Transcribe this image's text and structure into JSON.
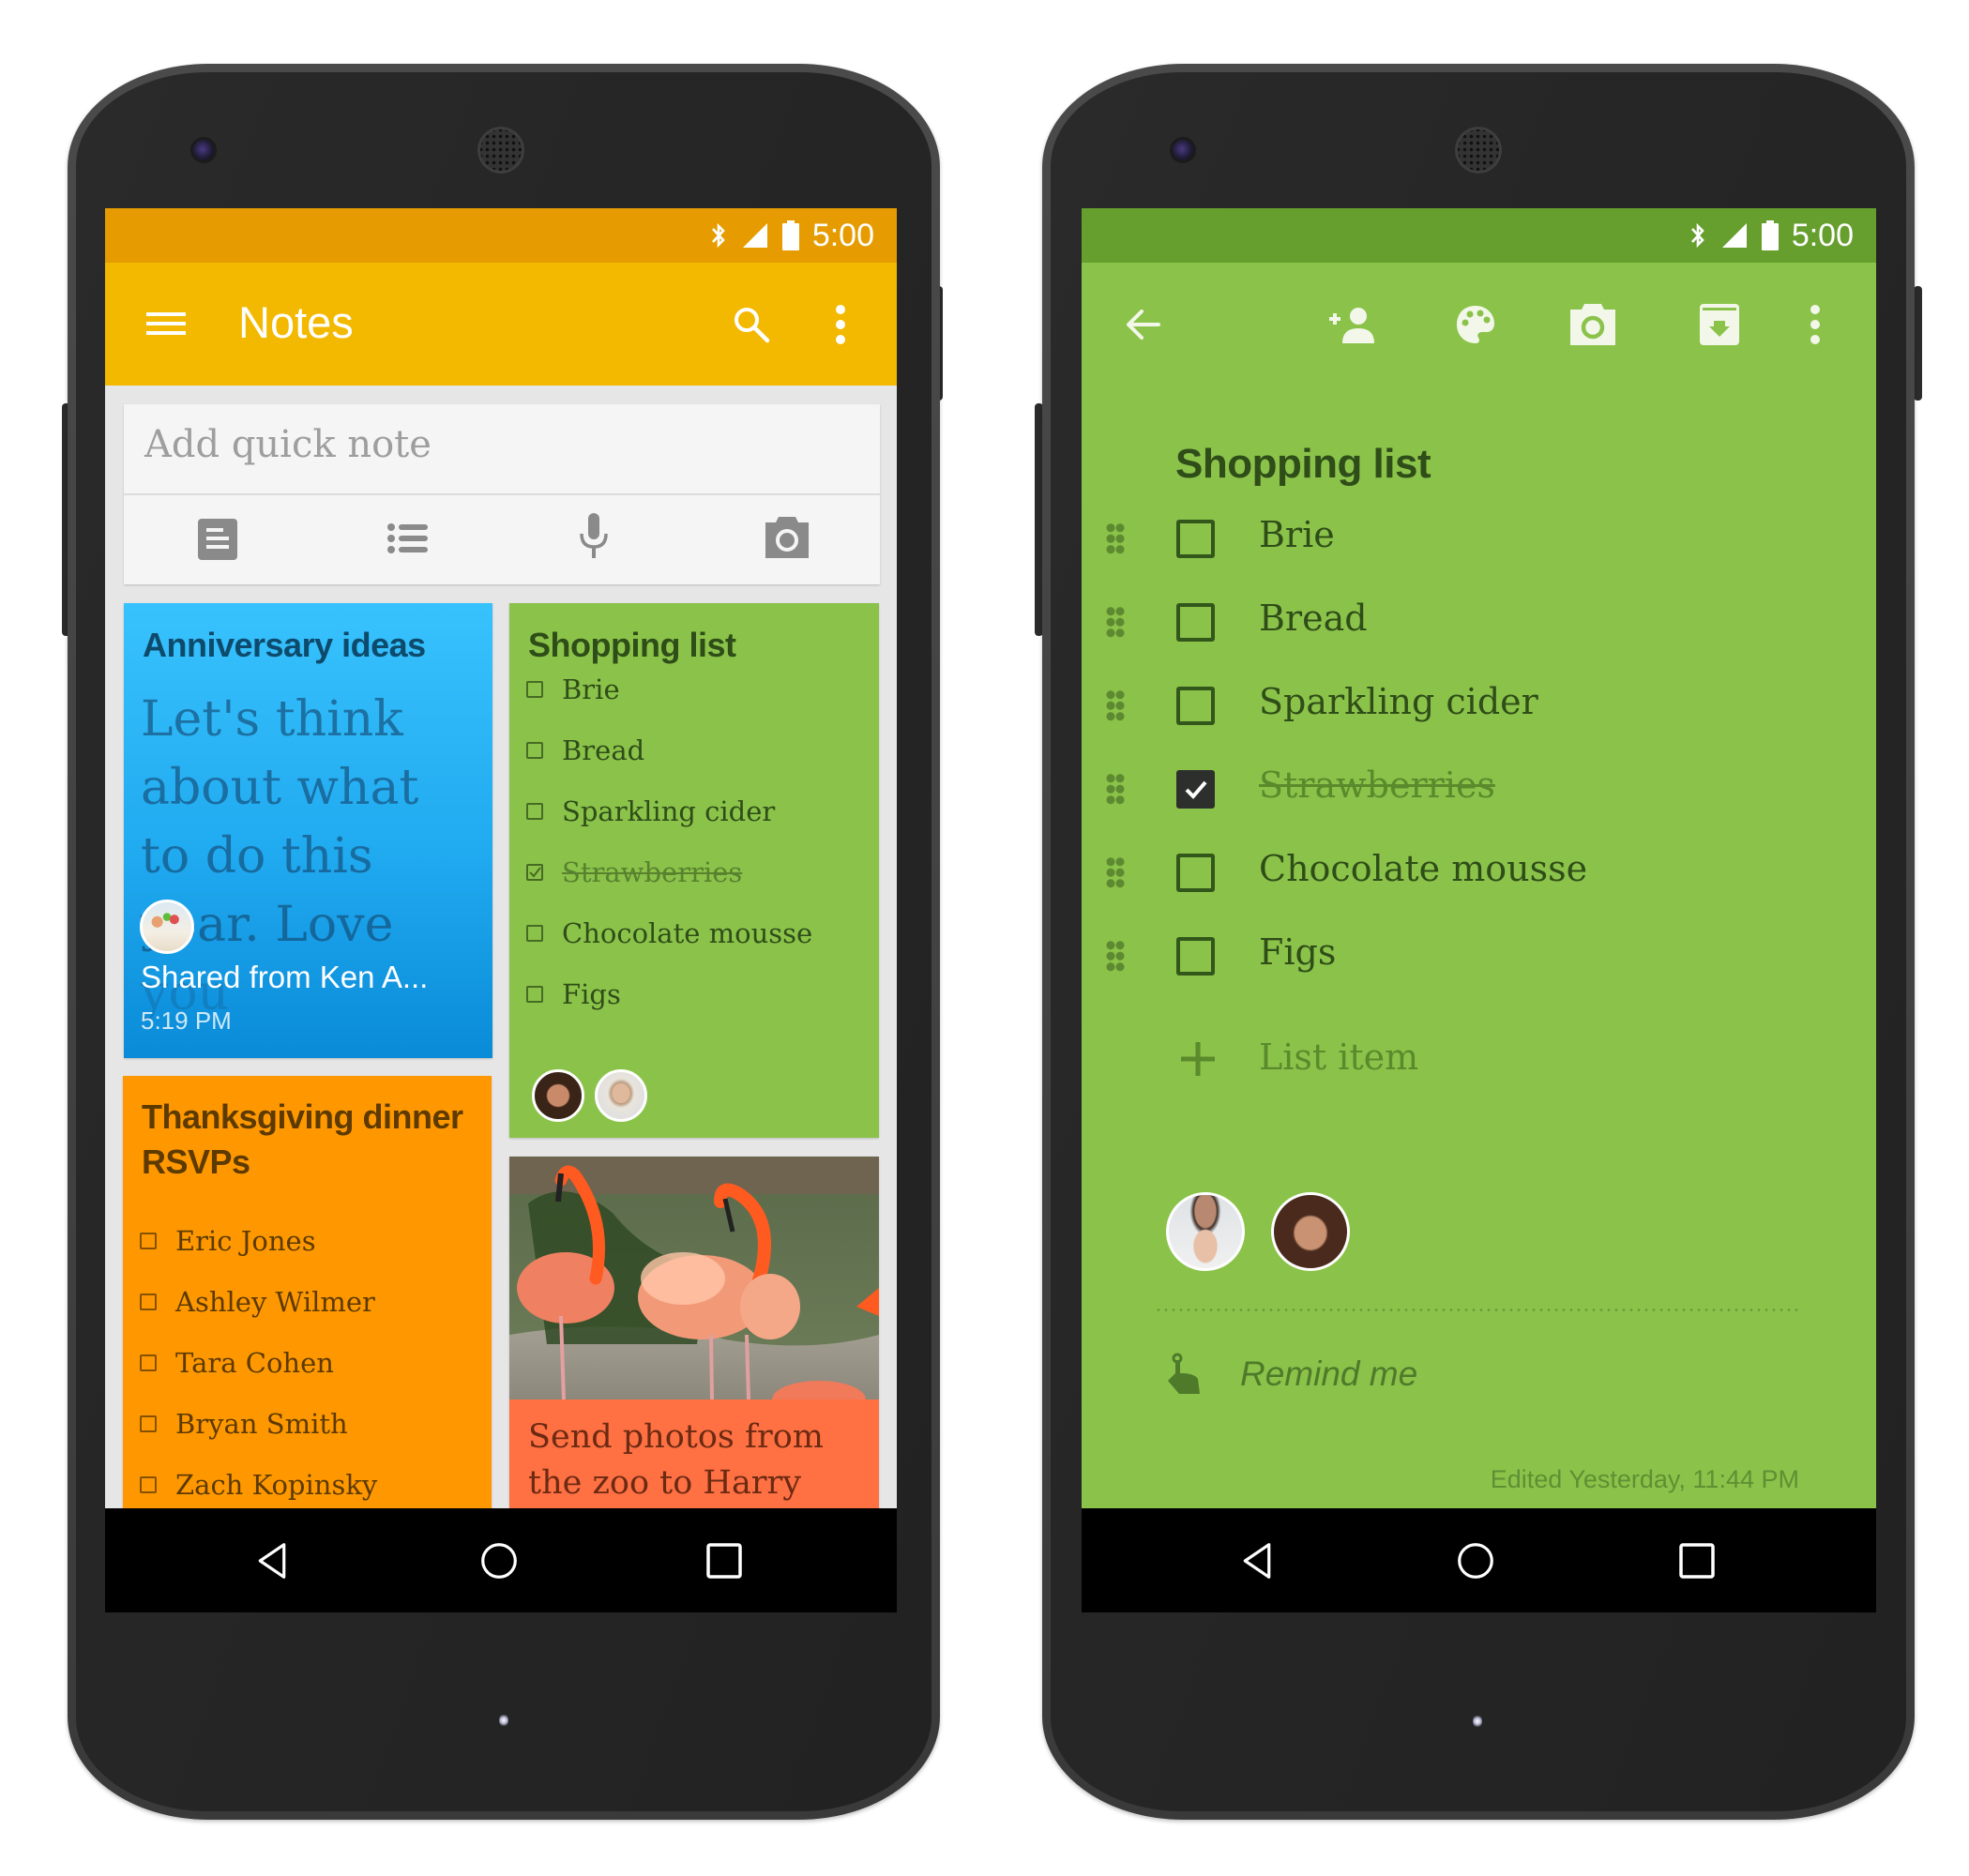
{
  "phone_left": {
    "status": {
      "time": "5:00",
      "icons": [
        "bluetooth-icon",
        "signal-icon",
        "battery-icon"
      ]
    },
    "colors": {
      "status_bar": "#e69c00",
      "app_bar": "#f3b800",
      "background": "#e6e6e6",
      "navbar": "#000000"
    },
    "app_bar": {
      "title": "Notes",
      "menu_icon": "hamburger-menu-icon",
      "search_icon": "search-icon",
      "more_icon": "more-vert-icon"
    },
    "quick_note": {
      "placeholder": "Add quick note",
      "actions": [
        {
          "icon": "text-note-icon",
          "label": "New note"
        },
        {
          "icon": "checklist-icon",
          "label": "New list"
        },
        {
          "icon": "microphone-icon",
          "label": "Voice note"
        },
        {
          "icon": "camera-icon",
          "label": "Photo note"
        }
      ]
    },
    "notes": {
      "anniversary": {
        "title": "Anniversary ideas",
        "body_lines": [
          "Let's think",
          "about what",
          "to do this",
          "year. Love",
          "you"
        ],
        "shared_from": "Shared from Ken A...",
        "time": "5:19 PM",
        "color": "#29b6f6"
      },
      "shopping": {
        "title": "Shopping list",
        "items": [
          {
            "text": "Brie",
            "checked": false
          },
          {
            "text": "Bread",
            "checked": false
          },
          {
            "text": "Sparkling cider",
            "checked": false
          },
          {
            "text": "Strawberries",
            "checked": true
          },
          {
            "text": "Chocolate mousse",
            "checked": false
          },
          {
            "text": "Figs",
            "checked": false
          }
        ],
        "collaborators": [
          "collaborator-avatar-woman",
          "collaborator-avatar-man"
        ],
        "color": "#8bc34a"
      },
      "thanksgiving": {
        "title_lines": [
          "Thanksgiving dinner",
          "RSVPs"
        ],
        "items": [
          {
            "text": "Eric Jones",
            "checked": false
          },
          {
            "text": "Ashley Wilmer",
            "checked": false
          },
          {
            "text": "Tara Cohen",
            "checked": false
          },
          {
            "text": "Bryan Smith",
            "checked": false
          },
          {
            "text": "Zach Kopinsky",
            "checked": false
          }
        ],
        "color": "#ff9800"
      },
      "zoo": {
        "image": "flamingos-photo",
        "caption_lines": [
          "Send photos from",
          "the zoo to Harry"
        ],
        "color": "#ff7043"
      }
    },
    "navbar": {
      "back": "back-icon",
      "home": "home-icon",
      "recents": "recents-icon"
    }
  },
  "phone_right": {
    "status": {
      "time": "5:00",
      "icons": [
        "bluetooth-icon",
        "signal-icon",
        "battery-icon"
      ]
    },
    "colors": {
      "status_bar": "#669f2e",
      "background": "#8bc34a",
      "text": "#2f4d18",
      "muted": "#5a8a2c"
    },
    "toolbar": {
      "back": "back-arrow-icon",
      "actions": [
        "add-collaborator-icon",
        "palette-icon",
        "camera-icon",
        "archive-icon",
        "more-vert-icon"
      ]
    },
    "note": {
      "title": "Shopping list",
      "items": [
        {
          "text": "Brie",
          "checked": false
        },
        {
          "text": "Bread",
          "checked": false
        },
        {
          "text": "Sparkling cider",
          "checked": false
        },
        {
          "text": "Strawberries",
          "checked": true
        },
        {
          "text": "Chocolate mousse",
          "checked": false
        },
        {
          "text": "Figs",
          "checked": false
        }
      ],
      "add_item_placeholder": "List item",
      "collaborators": [
        "collaborator-avatar-father-baby",
        "collaborator-avatar-woman"
      ],
      "remind_label": "Remind me",
      "edited": "Edited Yesterday, 11:44 PM"
    },
    "navbar": {
      "back": "back-icon",
      "home": "home-icon",
      "recents": "recents-icon"
    }
  }
}
